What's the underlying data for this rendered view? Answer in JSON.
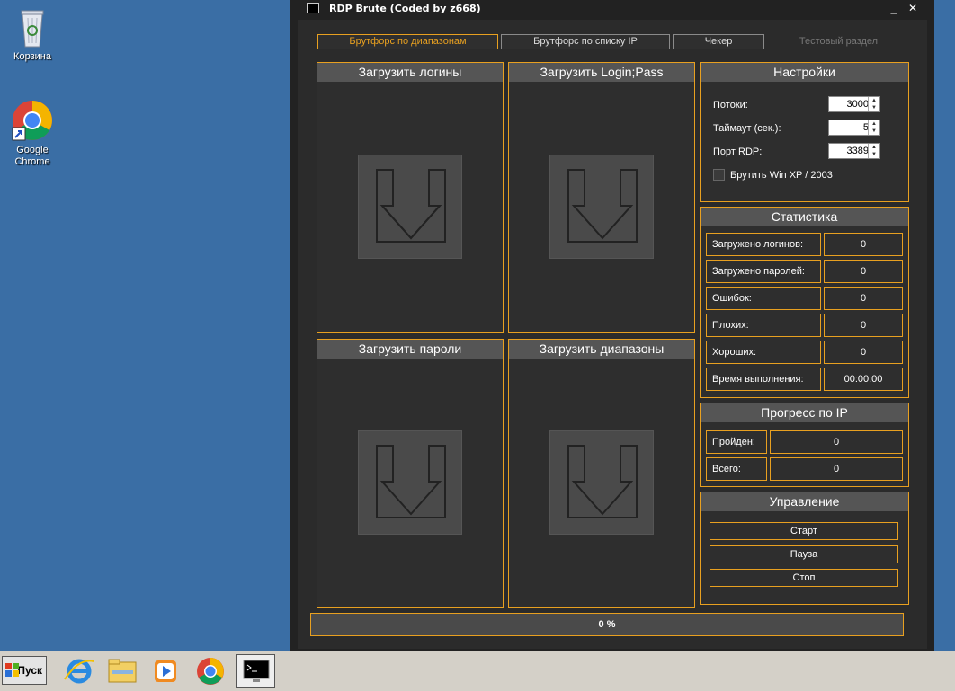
{
  "desktop": {
    "icons": [
      {
        "label": "Корзина",
        "icon": "recycle-bin-icon"
      },
      {
        "label_line1": "Google",
        "label_line2": "Chrome",
        "icon": "chrome-icon"
      }
    ]
  },
  "window": {
    "title": "RDP Brute (Coded by z668)",
    "minimize": "_",
    "close": "✕"
  },
  "tabs": [
    {
      "label": "Брутфорс по диапазонам",
      "state": "active"
    },
    {
      "label": "Брутфорс по списку IP",
      "state": "normal"
    },
    {
      "label": "Чекер",
      "state": "normal"
    },
    {
      "label": "Тестовый раздел",
      "state": "disabled"
    }
  ],
  "drop_panels": {
    "logins": "Загрузить логины",
    "loginpass": "Загрузить Login;Pass",
    "passwords": "Загрузить пароли",
    "ranges": "Загрузить диапазоны"
  },
  "settings": {
    "title": "Настройки",
    "threads_label": "Потоки:",
    "threads_value": "3000",
    "timeout_label": "Таймаут (сек.):",
    "timeout_value": "5",
    "port_label": "Порт RDP:",
    "port_value": "3389",
    "winxp_label": "Брутить Win XP / 2003",
    "winxp_checked": false
  },
  "stats": {
    "title": "Статистика",
    "rows": [
      {
        "label": "Загружено логинов:",
        "value": "0"
      },
      {
        "label": "Загружено паролей:",
        "value": "0"
      },
      {
        "label": "Ошибок:",
        "value": "0"
      },
      {
        "label": "Плохих:",
        "value": "0"
      },
      {
        "label": "Хороших:",
        "value": "0"
      },
      {
        "label": "Время выполнения:",
        "value": "00:00:00"
      }
    ]
  },
  "ip_progress": {
    "title": "Прогресс по IP",
    "passed_label": "Пройден:",
    "passed_value": "0",
    "total_label": "Всего:",
    "total_value": "0"
  },
  "control": {
    "title": "Управление",
    "start": "Старт",
    "pause": "Пауза",
    "stop": "Стоп"
  },
  "progress": {
    "text": "0 %",
    "fraction": 0
  },
  "taskbar": {
    "start_label": "Пуск",
    "apps": [
      "ie-icon",
      "explorer-icon",
      "media-player-icon",
      "chrome-icon",
      "console-icon"
    ]
  },
  "colors": {
    "accent": "#e8a020",
    "desktop": "#3a6ea5",
    "window_bg": "#2b2b2b"
  }
}
